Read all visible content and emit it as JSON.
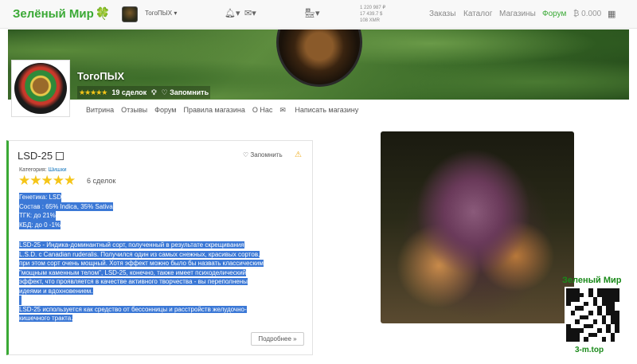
{
  "topnav": {
    "logo_text": "Зелёный Мир",
    "username": "ТогоПЫХ",
    "rates": [
      "1 220 987 ₽",
      "17 439.7 $",
      "108 XMR"
    ],
    "menu": [
      {
        "label": "Заказы",
        "active": false
      },
      {
        "label": "Каталог",
        "active": false
      },
      {
        "label": "Магазины",
        "active": false
      },
      {
        "label": "Форум",
        "active": true
      }
    ],
    "balance": "₿ 0.000"
  },
  "shop": {
    "name": "ТогоПЫХ",
    "stars": "★★★★★",
    "deals": "19 сделок",
    "remember": "Запомнить",
    "tabs": [
      "Витрина",
      "Отзывы",
      "Форум",
      "Правила магазина",
      "О Нас",
      "Написать магазину"
    ]
  },
  "product": {
    "title": "LSD-25",
    "remember": "Запомнить",
    "category_label": "Категория:",
    "category": "Шишки",
    "stars": "★★★★★",
    "deals": "6 сделок",
    "specs": [
      "Генетика: LSD",
      "Состав : 65% Indica, 35% Sativa",
      "ТГК: до 21%",
      "КБД: до 0 -1%"
    ],
    "description": [
      "LSD-25 - Индика-доминантный сорт, полученный в результате скрещивания",
      "L.S.D. с Canadian ruderalis. Получился один из самых снежных, красивых сортов,",
      "при этом сорт очень мощный. Хотя эффект можно было бы назвать классическим",
      "\"мощным каменным телом\", LSD-25, конечно, также имеет психоделический",
      "эффект, что проявляется в качестве активного творчества - вы переполнены",
      "идеями и вдохновением.",
      "",
      "LSD-25 используется как средство от бессонницы и расстройств желудочно-",
      "кишечного тракта."
    ],
    "more_button": "Подробнее »"
  },
  "watermark": {
    "title": "Зеленый Мир",
    "url": "3-m.top"
  },
  "colors": {
    "accent_green": "#3aa935",
    "selection_blue": "#3b78d6",
    "star_gold": "#f5c518"
  }
}
